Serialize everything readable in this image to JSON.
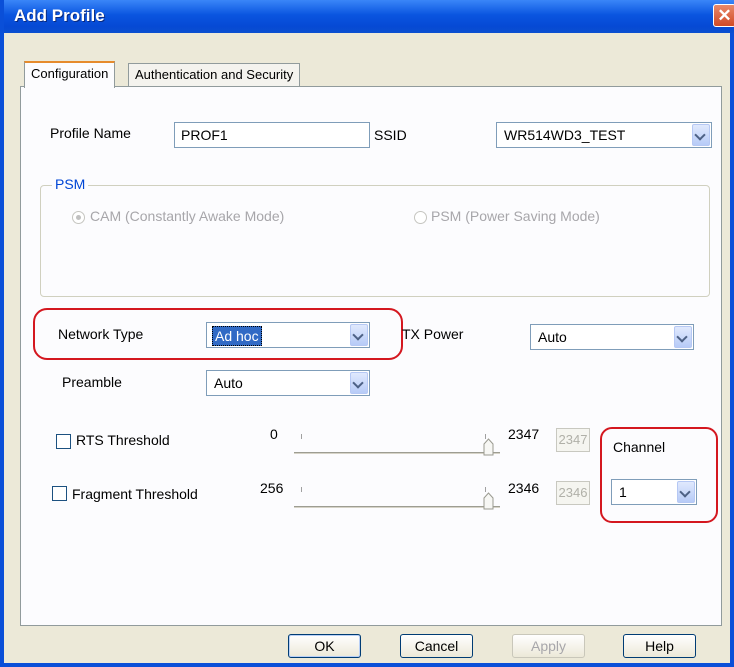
{
  "window": {
    "title": "Add Profile"
  },
  "tabs": [
    {
      "label": "Configuration",
      "active": true
    },
    {
      "label": "Authentication and Security",
      "active": false
    }
  ],
  "profile": {
    "name_label": "Profile Name",
    "name_value": "PROF1",
    "ssid_label": "SSID",
    "ssid_value": "WR514WD3_TEST"
  },
  "psm": {
    "group_title": "PSM",
    "option_cam": "CAM (Constantly Awake Mode)",
    "option_psm": "PSM (Power Saving Mode)",
    "selected": "CAM"
  },
  "network": {
    "type_label": "Network Type",
    "type_value": "Ad hoc",
    "tx_label": "TX Power",
    "tx_value": "Auto",
    "preamble_label": "Preamble",
    "preamble_value": "Auto"
  },
  "rts": {
    "label": "RTS Threshold",
    "checked": false,
    "min": "0",
    "max": "2347",
    "value": "2347"
  },
  "fragment": {
    "label": "Fragment Threshold",
    "checked": false,
    "min": "256",
    "max": "2346",
    "value": "2346"
  },
  "channel": {
    "label": "Channel",
    "value": "1"
  },
  "buttons": {
    "ok": "OK",
    "cancel": "Cancel",
    "apply": "Apply",
    "help": "Help"
  },
  "colors": {
    "titlebar": "#0a55e0",
    "highlight": "#d4171f",
    "selection": "#316ac5"
  }
}
